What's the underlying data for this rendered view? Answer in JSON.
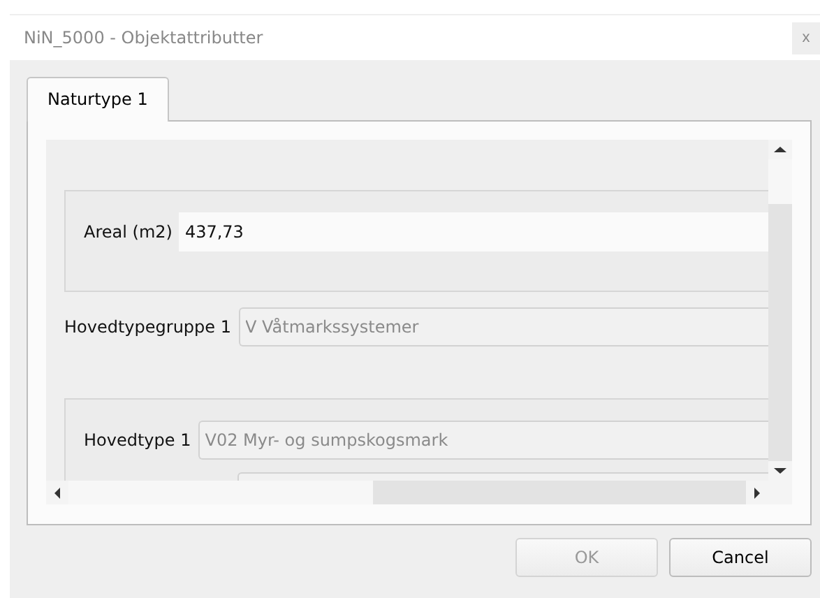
{
  "window": {
    "title": "NiN_5000 - Objektattributter",
    "close": "x"
  },
  "tabs": [
    {
      "label": "Naturtype 1",
      "selected": true
    }
  ],
  "groups": [
    {
      "kind": "box",
      "fields": [
        {
          "label": "Areal (m2)",
          "value": "437,73",
          "disabled": false
        }
      ]
    },
    {
      "kind": "plain",
      "fields": [
        {
          "label": "Hovedtypegruppe 1",
          "value": "V Våtmarkssystemer",
          "disabled": true
        }
      ]
    },
    {
      "kind": "box",
      "fields": [
        {
          "label": "Hovedtype 1",
          "value": "V02 Myr- og sumpskogsmark",
          "disabled": true
        }
      ]
    }
  ],
  "buttons": [
    {
      "label": "OK",
      "disabled": true
    },
    {
      "label": "Cancel",
      "disabled": false
    }
  ]
}
